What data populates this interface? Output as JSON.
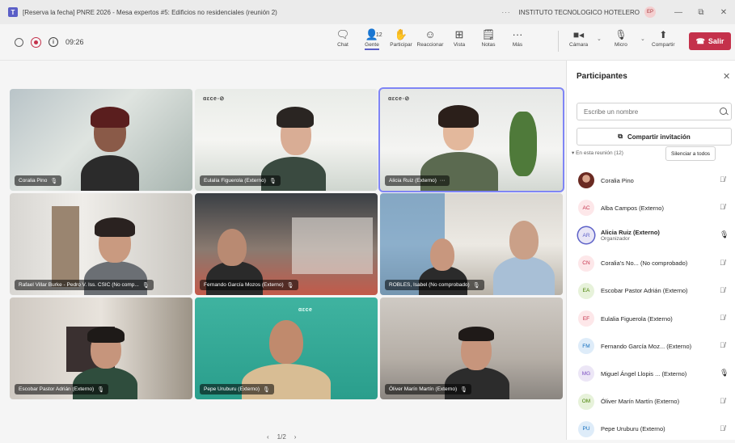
{
  "window": {
    "title": "[Reserva la fecha] PNRE 2026 - Mesa expertos #5: Edificios no residenciales (reunión 2)",
    "more": "···",
    "org": "INSTITUTO TECNOLOGICO HOTELERO",
    "user_initials": "EP",
    "minimize": "—",
    "maximize": "⧉",
    "close": "✕"
  },
  "toolbar": {
    "timer": "09:26",
    "actions": [
      {
        "icon": "chat-icon",
        "glyph": "🗨",
        "label": "Chat"
      },
      {
        "icon": "people-icon",
        "glyph": "👤",
        "label": "Gente",
        "count": "12",
        "active": true
      },
      {
        "icon": "raise-hand-icon",
        "glyph": "✋",
        "label": "Participar"
      },
      {
        "icon": "react-icon",
        "glyph": "☺",
        "label": "Reaccionar"
      },
      {
        "icon": "view-icon",
        "glyph": "⊞",
        "label": "Vista"
      },
      {
        "icon": "notes-icon",
        "glyph": "🗒",
        "label": "Notas"
      },
      {
        "icon": "more-icon",
        "glyph": "···",
        "label": "Más"
      }
    ],
    "camera_label": "Cámara",
    "mic_label": "Micro",
    "share_label": "Compartir",
    "leave_label": "Salir"
  },
  "videos": [
    {
      "name": "Coralia Pino",
      "muted": true
    },
    {
      "name": "Eulalia Figuerola (Externo)",
      "muted": true
    },
    {
      "name": "Alicia Ruiz (Externo)",
      "muted": false,
      "speaking": true
    },
    {
      "name": "Rafael Villar Burke - Pedro V. Iss. CSIC (No comp...",
      "muted": true
    },
    {
      "name": "Fernando García Mozos (Externo)",
      "muted": true
    },
    {
      "name": "ROBLES, Isabel (No comprobado)",
      "muted": true
    },
    {
      "name": "Escobar Pastor Adrián (Externo)",
      "muted": true
    },
    {
      "name": "Pepe Uruburu (Externo)",
      "muted": true
    },
    {
      "name": "Óliver Marín Martín (Externo)",
      "muted": true
    }
  ],
  "pager": {
    "prev": "‹",
    "text": "1/2",
    "next": "›"
  },
  "panel": {
    "title": "Participantes",
    "search_placeholder": "Escribe un nombre",
    "share_invite": "Compartir invitación",
    "in_meeting": "▾  En esta reunión (12)",
    "mute_all": "Silenciar a todos",
    "participants": [
      {
        "initials": "",
        "name": "Coralia Pino",
        "role": "",
        "bg": "#8a4b3a",
        "fg": "#ffffff",
        "muted": true,
        "photo": true
      },
      {
        "initials": "AC",
        "name": "Alba Campos (Externo)",
        "role": "",
        "bg": "#fde7e9",
        "fg": "#c4314b",
        "muted": true
      },
      {
        "initials": "AR",
        "name": "Alicia Ruiz (Externo)",
        "role": "Organizador",
        "bg": "#e8e6f6",
        "fg": "#5b5fc7",
        "muted": false,
        "ring": true
      },
      {
        "initials": "CN",
        "name": "Coralia's No... (No comprobado)",
        "role": "",
        "bg": "#fde7e9",
        "fg": "#c4314b",
        "muted": true
      },
      {
        "initials": "EA",
        "name": "Escobar Pastor Adrián (Externo)",
        "role": "",
        "bg": "#e7f2da",
        "fg": "#498205",
        "muted": true
      },
      {
        "initials": "EF",
        "name": "Eulalia Figuerola (Externo)",
        "role": "",
        "bg": "#fde7e9",
        "fg": "#c4314b",
        "muted": true
      },
      {
        "initials": "FM",
        "name": "Fernando García Moz... (Externo)",
        "role": "",
        "bg": "#deecf9",
        "fg": "#0f6cbd",
        "muted": true
      },
      {
        "initials": "MG",
        "name": "Miguel Ángel Llopis ... (Externo)",
        "role": "",
        "bg": "#ece6f6",
        "fg": "#7a4fc0",
        "muted": false
      },
      {
        "initials": "OM",
        "name": "Óliver Marín Martín (Externo)",
        "role": "",
        "bg": "#e7f2da",
        "fg": "#498205",
        "muted": true
      },
      {
        "initials": "PU",
        "name": "Pepe Uruburu (Externo)",
        "role": "",
        "bg": "#deecf9",
        "fg": "#0f6cbd",
        "muted": true
      }
    ]
  }
}
